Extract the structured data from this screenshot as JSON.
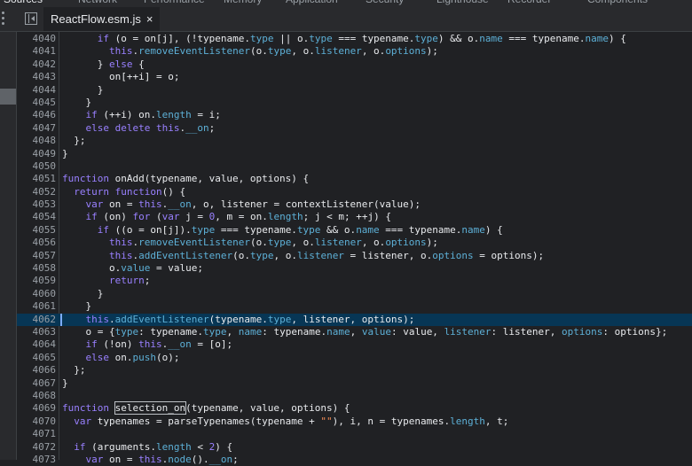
{
  "panel_tabs": [
    {
      "label": "Sources",
      "active": true
    },
    {
      "label": "Network",
      "active": false
    },
    {
      "label": "Performance",
      "active": false
    },
    {
      "label": "Memory",
      "active": false
    },
    {
      "label": "Application",
      "active": false
    },
    {
      "label": "Security",
      "active": false
    },
    {
      "label": "Lighthouse",
      "active": false
    },
    {
      "label": "Recorder",
      "active": false
    },
    {
      "label": "Components",
      "active": false
    }
  ],
  "editor": {
    "file_tab": {
      "label": "ReactFlow.esm.js",
      "close_icon": "×"
    },
    "highlighted_line": 4062,
    "selected_token": "selection_on",
    "colors": {
      "background": "#202124",
      "highlight": "#073655",
      "keyword": "#9980ff",
      "property": "#5db0d7",
      "string": "#f28b54"
    }
  },
  "code_lines": [
    {
      "num": "4040",
      "text": "      if (o = on[j], (!typename.type || o.type === typename.type) && o.name === typename.name) {"
    },
    {
      "num": "4041",
      "text": "        this.removeEventListener(o.type, o.listener, o.options);"
    },
    {
      "num": "4042",
      "text": "      } else {"
    },
    {
      "num": "4043",
      "text": "        on[++i] = o;"
    },
    {
      "num": "4044",
      "text": "      }"
    },
    {
      "num": "4045",
      "text": "    }"
    },
    {
      "num": "4046",
      "text": "    if (++i) on.length = i;"
    },
    {
      "num": "4047",
      "text": "    else delete this.__on;"
    },
    {
      "num": "4048",
      "text": "  };"
    },
    {
      "num": "4049",
      "text": "}"
    },
    {
      "num": "4050",
      "text": ""
    },
    {
      "num": "4051",
      "text": "function onAdd(typename, value, options) {"
    },
    {
      "num": "4052",
      "text": "  return function() {"
    },
    {
      "num": "4053",
      "text": "    var on = this.__on, o, listener = contextListener(value);"
    },
    {
      "num": "4054",
      "text": "    if (on) for (var j = 0, m = on.length; j < m; ++j) {"
    },
    {
      "num": "4055",
      "text": "      if ((o = on[j]).type === typename.type && o.name === typename.name) {"
    },
    {
      "num": "4056",
      "text": "        this.removeEventListener(o.type, o.listener, o.options);"
    },
    {
      "num": "4057",
      "text": "        this.addEventListener(o.type, o.listener = listener, o.options = options);"
    },
    {
      "num": "4058",
      "text": "        o.value = value;"
    },
    {
      "num": "4059",
      "text": "        return;"
    },
    {
      "num": "4060",
      "text": "      }"
    },
    {
      "num": "4061",
      "text": "    }"
    },
    {
      "num": "4062",
      "text": "    this.addEventListener(typename.type, listener, options);"
    },
    {
      "num": "4063",
      "text": "    o = {type: typename.type, name: typename.name, value: value, listener: listener, options: options};"
    },
    {
      "num": "4064",
      "text": "    if (!on) this.__on = [o];"
    },
    {
      "num": "4065",
      "text": "    else on.push(o);"
    },
    {
      "num": "4066",
      "text": "  };"
    },
    {
      "num": "4067",
      "text": "}"
    },
    {
      "num": "4068",
      "text": ""
    },
    {
      "num": "4069",
      "text": "function selection_on(typename, value, options) {"
    },
    {
      "num": "4070",
      "text": "  var typenames = parseTypenames(typename + \"\"), i, n = typenames.length, t;"
    },
    {
      "num": "4071",
      "text": ""
    },
    {
      "num": "4072",
      "text": "  if (arguments.length < 2) {"
    },
    {
      "num": "4073",
      "text": "    var on = this.node().__on;"
    }
  ]
}
